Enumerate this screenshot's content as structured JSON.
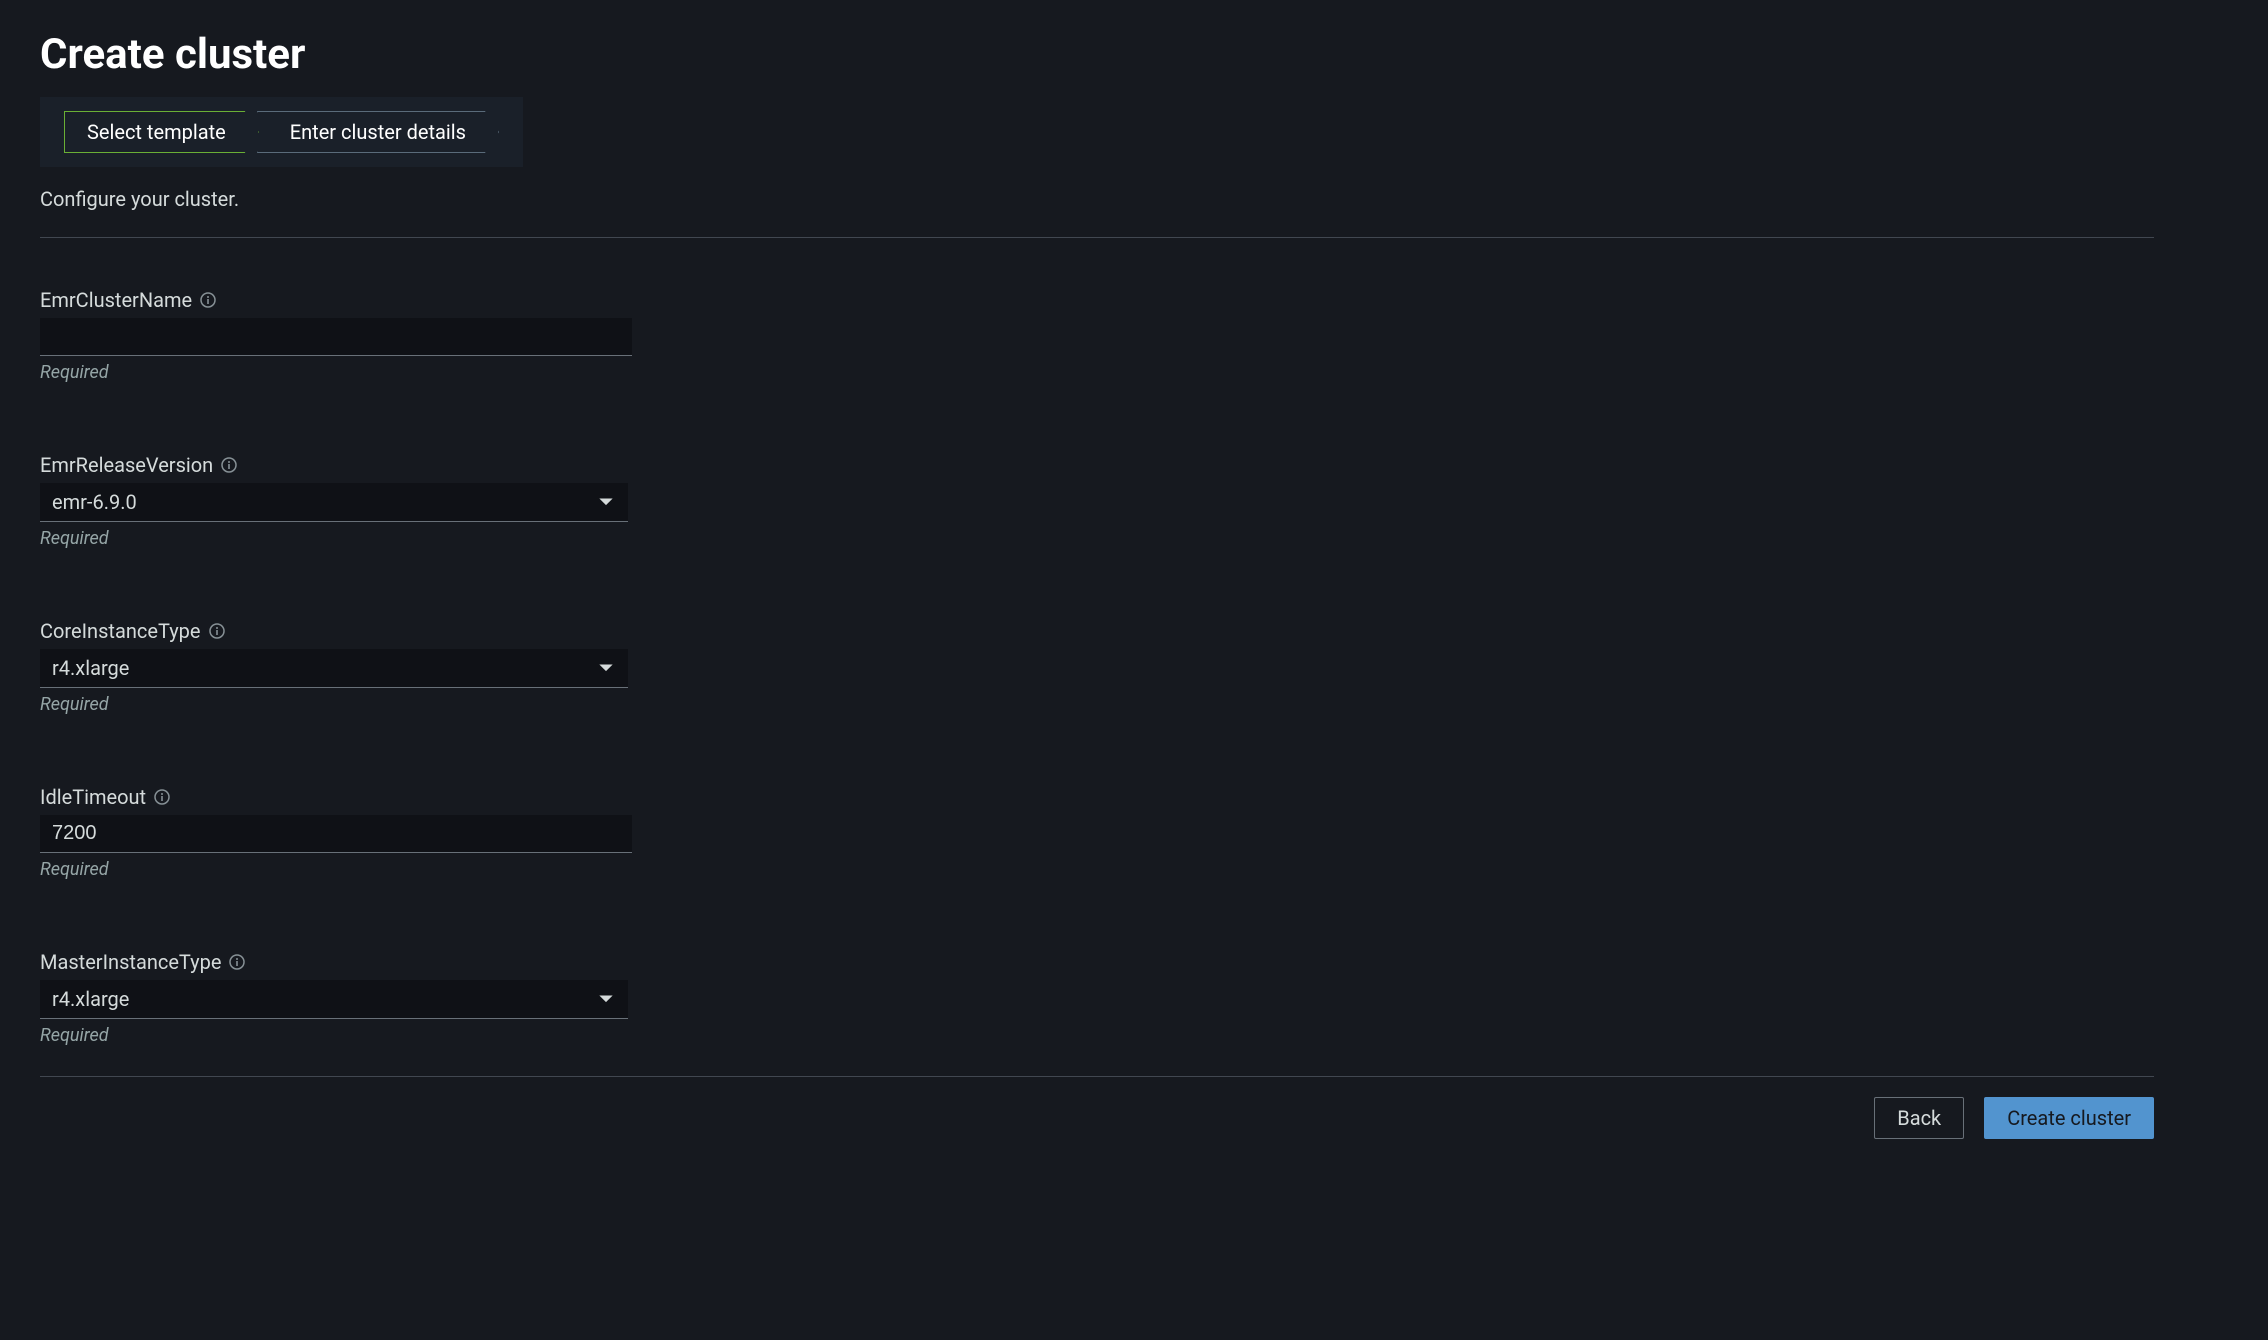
{
  "page": {
    "title": "Create cluster",
    "subtitle": "Configure your cluster."
  },
  "wizard": {
    "step1": "Select template",
    "step2": "Enter cluster details"
  },
  "fields": {
    "clusterName": {
      "label": "EmrClusterName",
      "value": "",
      "helper": "Required"
    },
    "releaseVersion": {
      "label": "EmrReleaseVersion",
      "value": "emr-6.9.0",
      "helper": "Required"
    },
    "coreInstanceType": {
      "label": "CoreInstanceType",
      "value": "r4.xlarge",
      "helper": "Required"
    },
    "idleTimeout": {
      "label": "IdleTimeout",
      "value": "7200",
      "helper": "Required"
    },
    "masterInstanceType": {
      "label": "MasterInstanceType",
      "value": "r4.xlarge",
      "helper": "Required"
    }
  },
  "actions": {
    "back": "Back",
    "create": "Create cluster"
  }
}
